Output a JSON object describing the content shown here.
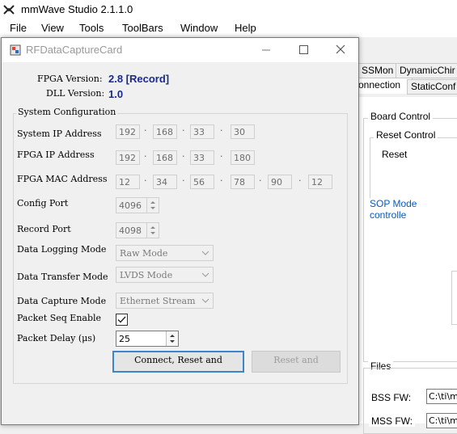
{
  "app": {
    "title": "mmWave Studio 2.1.1.0",
    "menu": [
      "File",
      "View",
      "Tools",
      "ToolBars",
      "Window",
      "Help"
    ]
  },
  "background_panel": {
    "tabs": [
      "SSMon",
      "DynamicChir",
      "onnection",
      "StaticConf"
    ],
    "board_control": "Board Control",
    "reset_control": "Reset Control",
    "reset_label": "Reset",
    "sop_link": "SOP Mode controlle",
    "files_label": "Files",
    "bss_fw_label": "BSS FW:",
    "bss_fw_value": "C:\\ti\\m",
    "mss_fw_label": "MSS FW:",
    "mss_fw_value": "C:\\ti\\m"
  },
  "dialog": {
    "title": "RFDataCaptureCard",
    "fpga_version_label": "FPGA Version:",
    "fpga_version_value": "2.8 [Record]",
    "dll_version_label": "DLL Version:",
    "dll_version_value": "1.0",
    "system_config_title": "System Configuration",
    "system_ip_label": "System IP Address",
    "system_ip": [
      "192",
      "168",
      "33",
      "30"
    ],
    "fpga_ip_label": "FPGA IP Address",
    "fpga_ip": [
      "192",
      "168",
      "33",
      "180"
    ],
    "fpga_mac_label": "FPGA MAC Address",
    "fpga_mac": [
      "12",
      "34",
      "56",
      "78",
      "90",
      "12"
    ],
    "config_port_label": "Config Port",
    "config_port_value": "4096",
    "record_port_label": "Record Port",
    "record_port_value": "4098",
    "data_logging_label": "Data Logging Mode",
    "data_logging_value": "Raw Mode",
    "data_transfer_label": "Data Transfer Mode",
    "data_transfer_value": "LVDS Mode",
    "data_capture_label": "Data Capture Mode",
    "data_capture_value": "Ethernet Stream",
    "packet_seq_label": "Packet Seq Enable",
    "packet_seq_checked": true,
    "packet_delay_label": "Packet Delay (μs)",
    "packet_delay_value": "25",
    "connect_button": "Connect, Reset and",
    "reset_button": "Reset and"
  }
}
